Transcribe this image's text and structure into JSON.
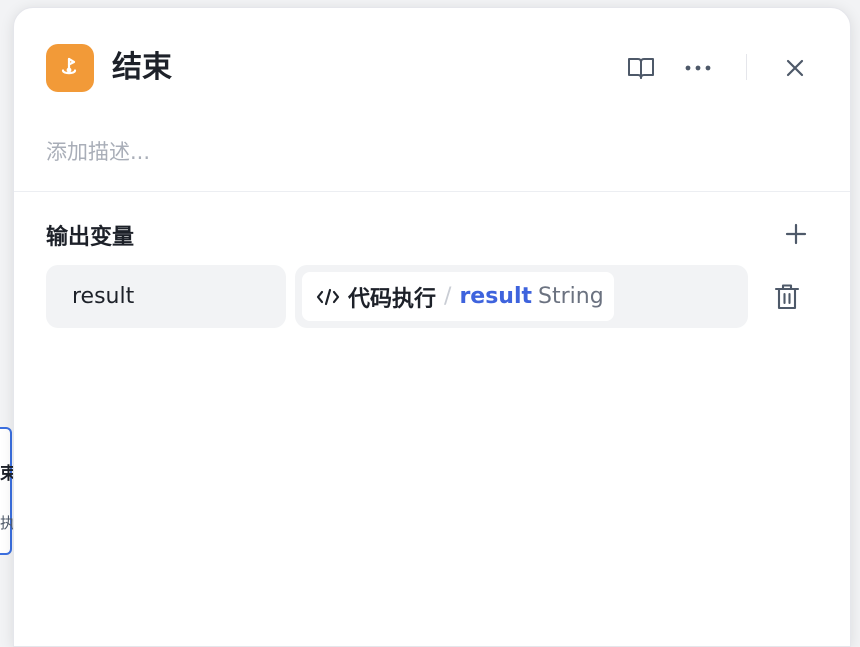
{
  "background_node": {
    "title": "束",
    "subtitle": "执"
  },
  "panel": {
    "title": "结束",
    "description_placeholder": "添加描述...",
    "icon": "end-node-icon",
    "accent_color": "#f29a38",
    "header_buttons": [
      "book-icon",
      "more-icon",
      "close-icon"
    ]
  },
  "output_section": {
    "title": "输出变量",
    "add_icon": "plus-icon",
    "rows": [
      {
        "name": "result",
        "ref_icon": "code-icon",
        "ref_node": "代码执行",
        "ref_separator": "/",
        "ref_variable": "result",
        "ref_type": "String",
        "delete_icon": "trash-icon"
      }
    ]
  }
}
